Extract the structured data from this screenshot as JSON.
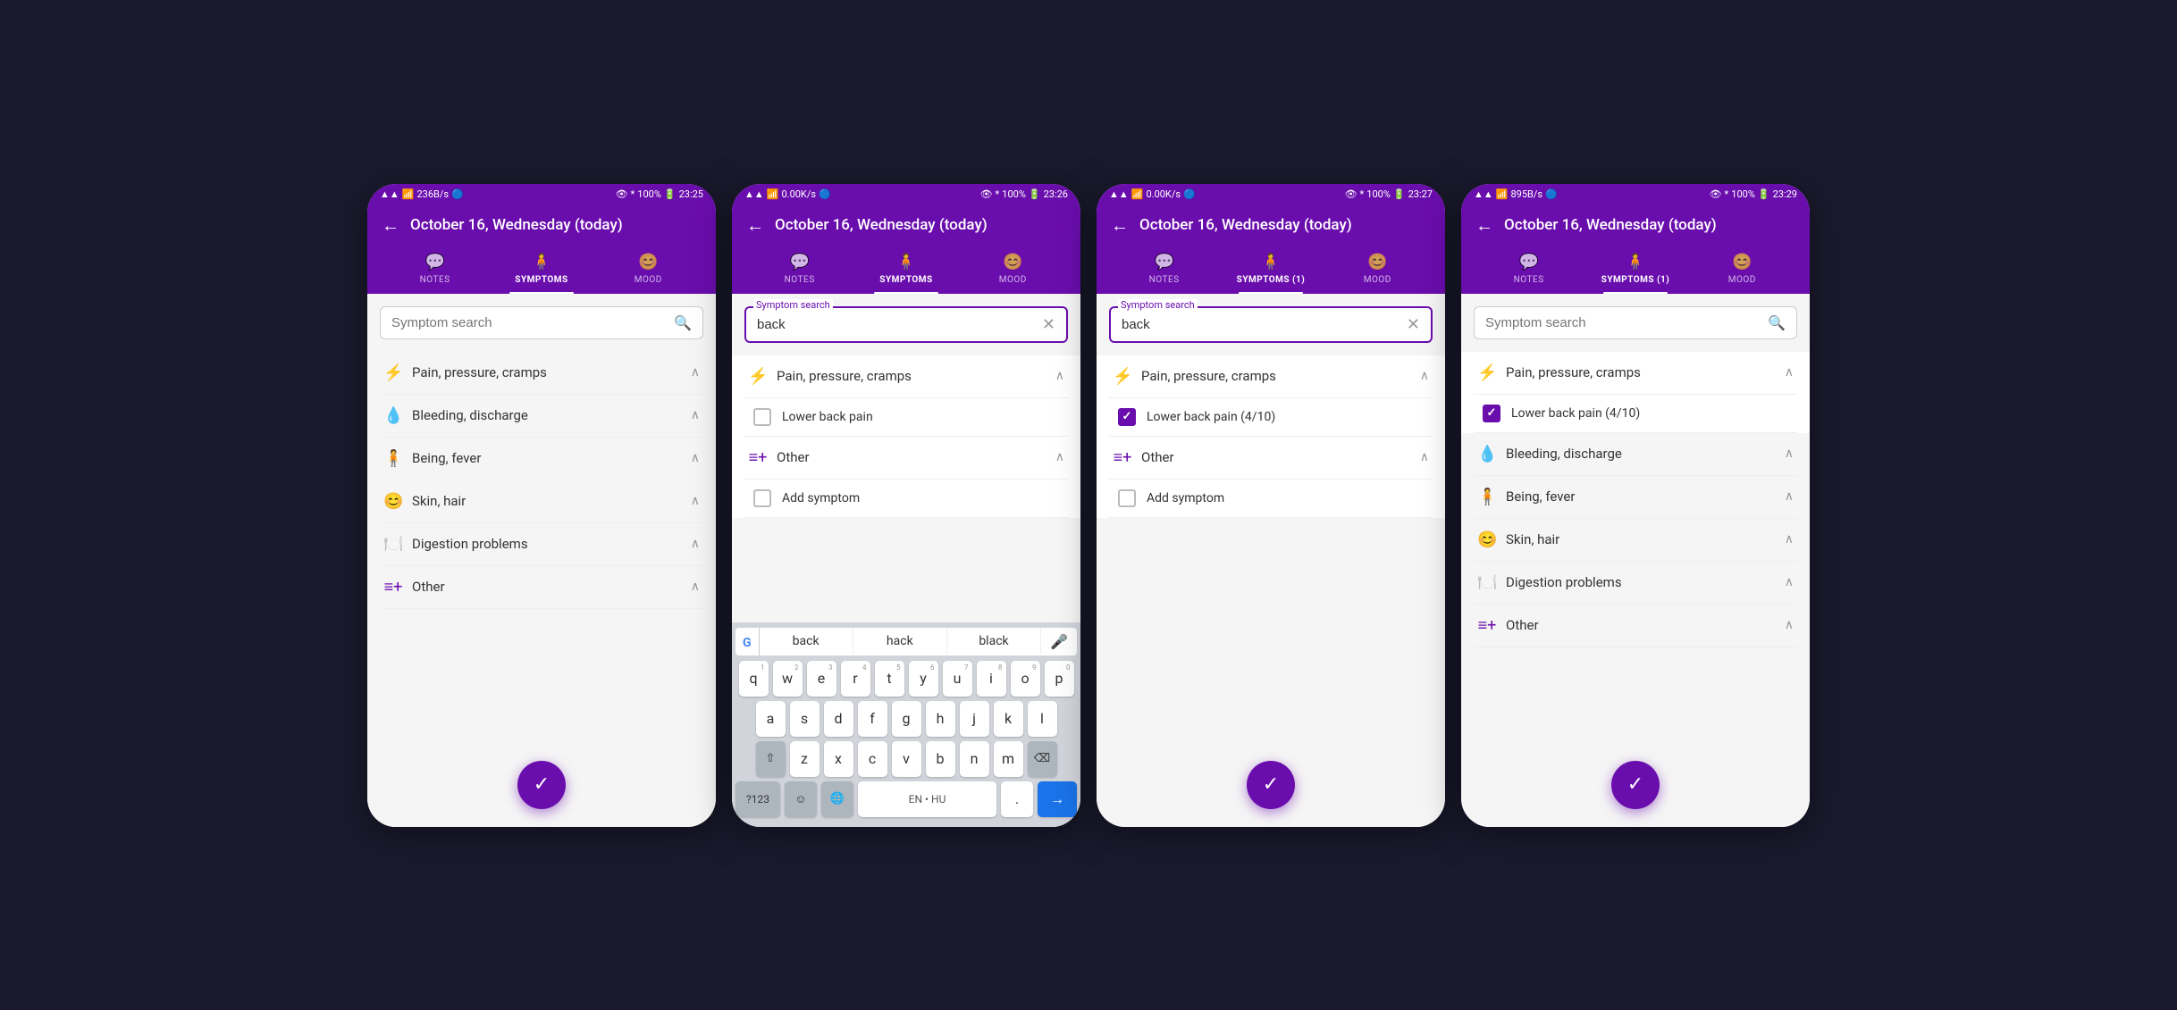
{
  "colors": {
    "purple": "#6a0dad",
    "purple_light": "#7c3aed",
    "white": "#ffffff",
    "gray_bg": "#f5f5f5"
  },
  "screens": [
    {
      "id": "screen1",
      "status": {
        "left": "236B/s",
        "time": "23:25",
        "battery": "100%"
      },
      "header_title": "October 16, Wednesday (today)",
      "tabs": [
        {
          "label": "NOTES",
          "icon": "💬",
          "active": false
        },
        {
          "label": "SYMPTOMS",
          "icon": "🧍",
          "active": true
        },
        {
          "label": "MOOD",
          "icon": "😊",
          "active": false
        }
      ],
      "search": {
        "placeholder": "Symptom search",
        "value": "",
        "active": false
      },
      "categories": [
        {
          "icon": "⚡",
          "label": "Pain, pressure, cramps",
          "expanded": false
        },
        {
          "icon": "💧",
          "label": "Bleeding, discharge",
          "expanded": false
        },
        {
          "icon": "🧍",
          "label": "Being, fever",
          "expanded": false
        },
        {
          "icon": "😊",
          "label": "Skin, hair",
          "expanded": false
        },
        {
          "icon": "🍽️",
          "label": "Digestion problems",
          "expanded": false
        },
        {
          "icon": "≡+",
          "label": "Other",
          "expanded": false
        }
      ],
      "fab": "✓",
      "show_keyboard": false
    },
    {
      "id": "screen2",
      "status": {
        "left": "0.00K/s",
        "time": "23:26",
        "battery": "100%"
      },
      "header_title": "October 16, Wednesday (today)",
      "tabs": [
        {
          "label": "NOTES",
          "icon": "💬",
          "active": false
        },
        {
          "label": "SYMPTOMS",
          "icon": "🧍",
          "active": true
        },
        {
          "label": "MOOD",
          "icon": "😊",
          "active": false
        }
      ],
      "search": {
        "placeholder": "Symptom search",
        "value": "back",
        "active": true,
        "label": "Symptom search"
      },
      "categories": [
        {
          "icon": "⚡",
          "label": "Pain, pressure, cramps",
          "expanded": true,
          "symptoms": [
            {
              "label": "Lower back pain",
              "checked": false
            }
          ]
        },
        {
          "icon": "≡+",
          "label": "Other",
          "expanded": true,
          "symptoms": [
            {
              "label": "Add symptom",
              "checked": false,
              "add": true
            }
          ]
        }
      ],
      "fab": "✓",
      "show_keyboard": true,
      "keyboard": {
        "suggestions": [
          "back",
          "hack",
          "black"
        ],
        "rows": [
          [
            "q",
            "w",
            "e",
            "r",
            "t",
            "y",
            "u",
            "i",
            "o",
            "p"
          ],
          [
            "a",
            "s",
            "d",
            "f",
            "g",
            "h",
            "j",
            "k",
            "l"
          ],
          [
            "⇧",
            "z",
            "x",
            "c",
            "v",
            "b",
            "n",
            "m",
            "⌫"
          ]
        ],
        "bottom": {
          "num": "?123",
          "emoji": "☺",
          "globe": "🌐",
          "lang": "EN • HU",
          "period": ".",
          "action": "→"
        }
      }
    },
    {
      "id": "screen3",
      "status": {
        "left": "0.00K/s",
        "time": "23:27",
        "battery": "100%"
      },
      "header_title": "October 16, Wednesday (today)",
      "tabs": [
        {
          "label": "NOTES",
          "icon": "💬",
          "active": false
        },
        {
          "label": "SYMPTOMS (1)",
          "icon": "🧍",
          "active": true
        },
        {
          "label": "MOOD",
          "icon": "😊",
          "active": false
        }
      ],
      "search": {
        "placeholder": "Symptom search",
        "value": "back",
        "active": true,
        "label": "Symptom search"
      },
      "categories": [
        {
          "icon": "⚡",
          "label": "Pain, pressure, cramps",
          "expanded": true,
          "symptoms": [
            {
              "label": "Lower back pain (4/10)",
              "checked": true
            }
          ]
        },
        {
          "icon": "≡+",
          "label": "Other",
          "expanded": true,
          "symptoms": [
            {
              "label": "Add symptom",
              "checked": false,
              "add": true
            }
          ]
        }
      ],
      "fab": "✓",
      "show_keyboard": false
    },
    {
      "id": "screen4",
      "status": {
        "left": "895B/s",
        "time": "23:29",
        "battery": "100%"
      },
      "header_title": "October 16, Wednesday (today)",
      "tabs": [
        {
          "label": "NOTES",
          "icon": "💬",
          "active": false
        },
        {
          "label": "SYMPTOMS (1)",
          "icon": "🧍",
          "active": true
        },
        {
          "label": "MOOD",
          "icon": "😊",
          "active": false
        }
      ],
      "search": {
        "placeholder": "Symptom search",
        "value": "",
        "active": false
      },
      "categories": [
        {
          "icon": "⚡",
          "label": "Pain, pressure, cramps",
          "expanded": true,
          "symptoms": [
            {
              "label": "Lower back pain (4/10)",
              "checked": true
            }
          ]
        },
        {
          "icon": "💧",
          "label": "Bleeding, discharge",
          "expanded": false
        },
        {
          "icon": "🧍",
          "label": "Being, fever",
          "expanded": false
        },
        {
          "icon": "😊",
          "label": "Skin, hair",
          "expanded": false
        },
        {
          "icon": "🍽️",
          "label": "Digestion problems",
          "expanded": false
        },
        {
          "icon": "≡+",
          "label": "Other",
          "expanded": false
        }
      ],
      "fab": "✓",
      "show_keyboard": false
    }
  ]
}
